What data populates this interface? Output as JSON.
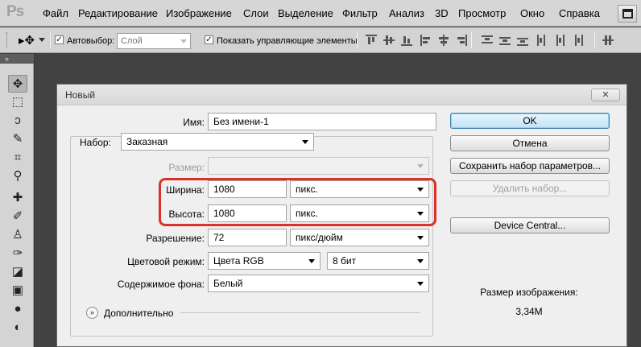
{
  "app": {
    "logo": "Ps",
    "menu": [
      "Файл",
      "Редактирование",
      "Изображение",
      "Слои",
      "Выделение",
      "Фильтр",
      "Анализ",
      "3D",
      "Просмотр",
      "Окно",
      "Справка"
    ]
  },
  "options_bar": {
    "auto_select_label": "Автовыбор:",
    "auto_select_value": "Слой",
    "show_controls_label": "Показать управляющие элементы",
    "checkbox_mark": "✓"
  },
  "dialog": {
    "title": "Новый",
    "close_label": "✕",
    "name_label": "Имя:",
    "name_value": "Без имени-1",
    "preset_label": "Набор:",
    "preset_value": "Заказная",
    "size_label": "Размер:",
    "size_value": "",
    "width_label": "Ширина:",
    "width_value": "1080",
    "width_unit": "пикс.",
    "height_label": "Высота:",
    "height_value": "1080",
    "height_unit": "пикс.",
    "resolution_label": "Разрешение:",
    "resolution_value": "72",
    "resolution_unit": "пикс/дюйм",
    "color_mode_label": "Цветовой режим:",
    "color_mode_value": "Цвета RGB",
    "bit_depth_value": "8 бит",
    "background_label": "Содержимое фона:",
    "background_value": "Белый",
    "advanced_label": "Дополнительно",
    "advanced_icon": "»",
    "buttons": {
      "ok": "OK",
      "cancel": "Отмена",
      "save_preset": "Сохранить набор параметров...",
      "delete_preset": "Удалить набор...",
      "device_central": "Device Central..."
    },
    "image_size_label": "Размер изображения:",
    "image_size_value": "3,34M"
  },
  "colors": {
    "highlight": "#d9322b",
    "ok_button": "#bfe3f8"
  }
}
